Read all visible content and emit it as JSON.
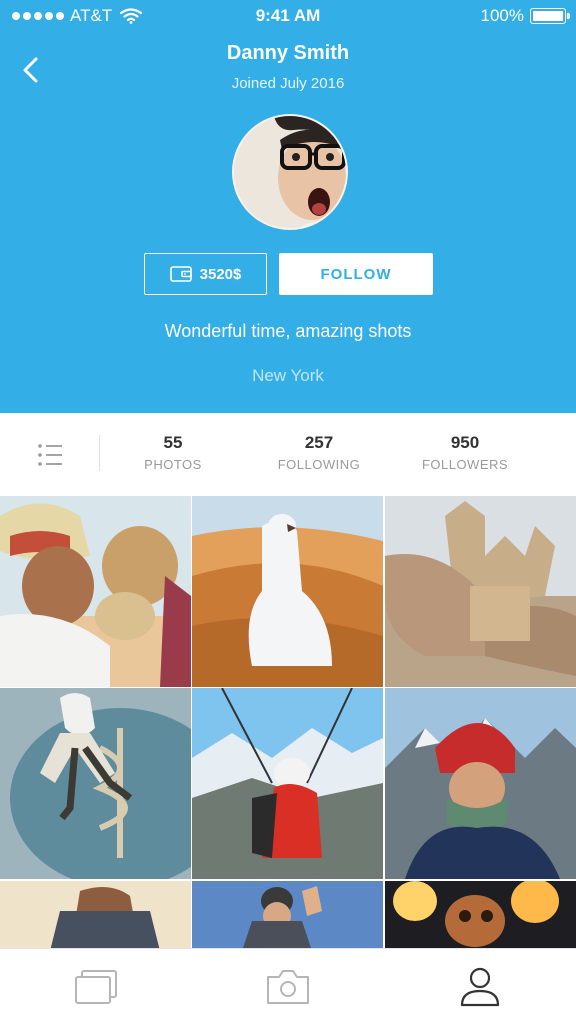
{
  "status_bar": {
    "carrier": "AT&T",
    "time": "9:41 AM",
    "battery": "100%"
  },
  "profile": {
    "name": "Danny Smith",
    "joined": "Joined July 2016",
    "wallet_amount": "3520$",
    "follow_label": "FOLLOW",
    "bio": "Wonderful time, amazing shots",
    "location": "New York"
  },
  "stats": [
    {
      "value": "55",
      "label": "PHOTOS"
    },
    {
      "value": "257",
      "label": "FOLLOWING"
    },
    {
      "value": "950",
      "label": "FOLLOWERS"
    }
  ],
  "photos": [
    {
      "subject": "man kissing camel"
    },
    {
      "subject": "man in desert dunes"
    },
    {
      "subject": "sandcastle in hands"
    },
    {
      "subject": "skydiver over palm island"
    },
    {
      "subject": "paraglider in mountains"
    },
    {
      "subject": "climber selfie on summit"
    },
    {
      "subject": "dog on rocks"
    },
    {
      "subject": "skydiving selfie"
    },
    {
      "subject": "fire show sculpture"
    }
  ],
  "tabs": [
    {
      "icon": "gallery-icon",
      "active": false
    },
    {
      "icon": "camera-icon",
      "active": false
    },
    {
      "icon": "profile-icon",
      "active": true
    }
  ],
  "colors": {
    "brand": "#33aee6",
    "text_dark": "#333333",
    "text_muted": "#9a9a9a"
  }
}
